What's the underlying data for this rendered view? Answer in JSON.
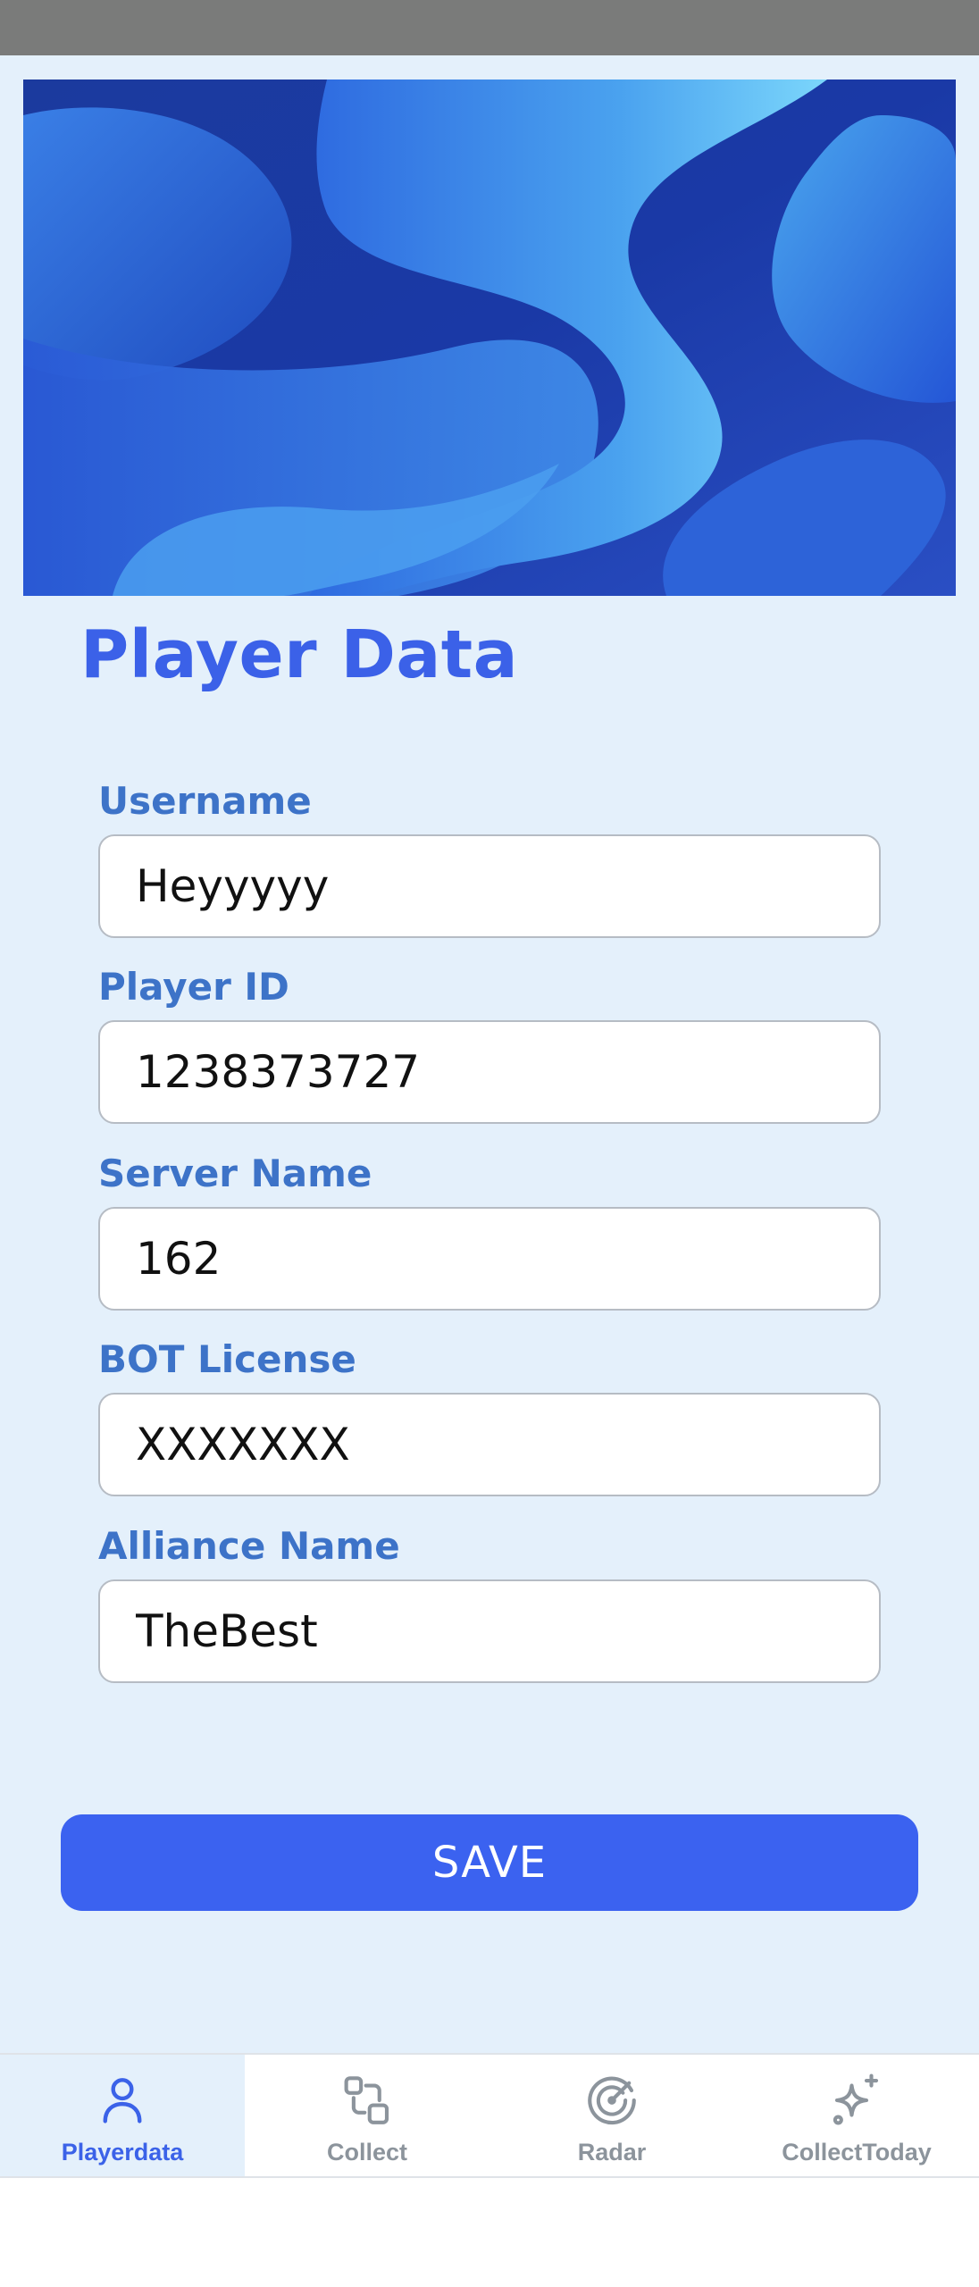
{
  "page": {
    "title": "Player Data"
  },
  "form": {
    "fields": [
      {
        "label": "Username",
        "value": "Heyyyyy"
      },
      {
        "label": "Player ID",
        "value": "1238373727"
      },
      {
        "label": "Server Name",
        "value": "162"
      },
      {
        "label": "BOT License",
        "value": "XXXXXXX"
      },
      {
        "label": "Alliance Name",
        "value": "TheBest"
      }
    ],
    "save_label": "SAVE"
  },
  "nav": {
    "items": [
      {
        "label": "Playerdata",
        "icon": "person-icon",
        "active": true
      },
      {
        "label": "Collect",
        "icon": "collect-icon",
        "active": false
      },
      {
        "label": "Radar",
        "icon": "radar-icon",
        "active": false
      },
      {
        "label": "CollectToday",
        "icon": "sparkle-icon",
        "active": false
      }
    ]
  },
  "colors": {
    "accent": "#3b62f0",
    "label": "#3d73c8",
    "background": "#e4f0fb",
    "status_bar": "#7a7b7a",
    "nav_inactive": "#8c949c"
  }
}
